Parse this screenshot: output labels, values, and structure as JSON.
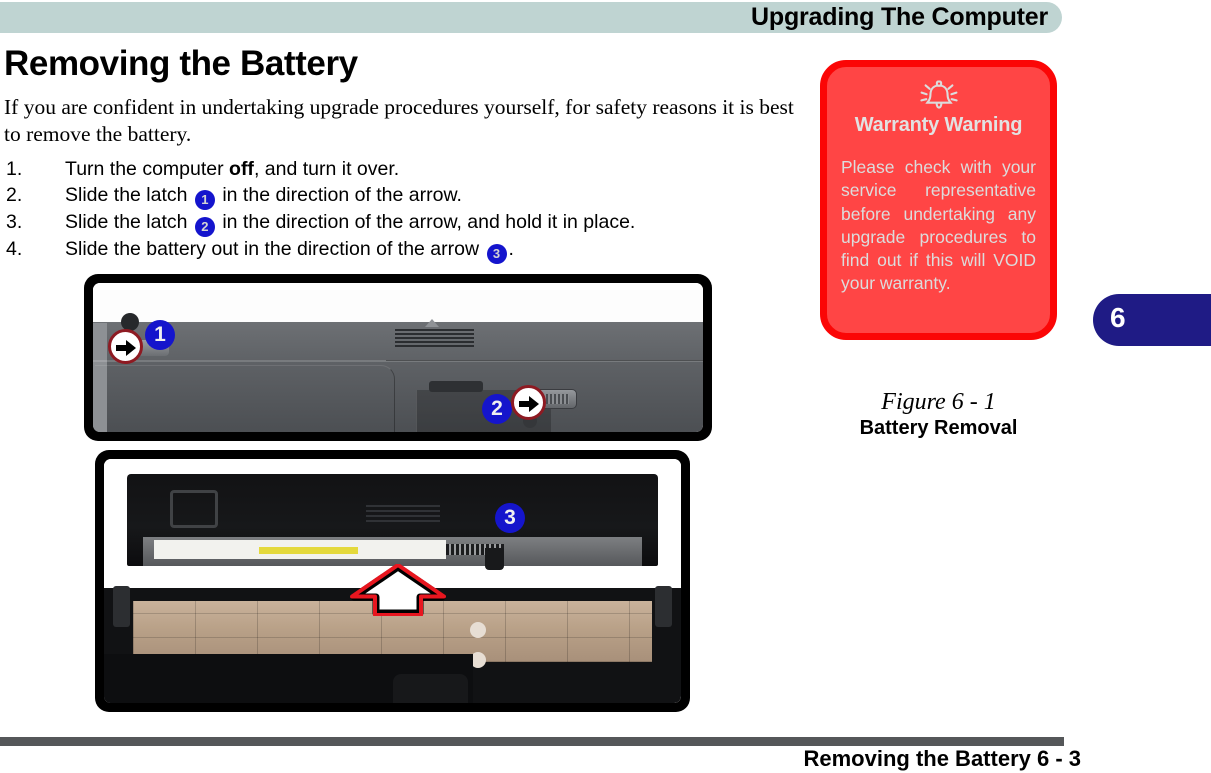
{
  "header": {
    "title": "Upgrading The Computer"
  },
  "chapter_tab": {
    "number": "6"
  },
  "main": {
    "heading": "Removing the Battery",
    "intro": "If you are confident in undertaking upgrade procedures yourself, for safety reasons it is best to remove the battery.",
    "steps": [
      {
        "num": "1.",
        "pre": "Turn the computer ",
        "bold": "off",
        "post": ", and turn it over.",
        "badge": null,
        "tail": ""
      },
      {
        "num": "2.",
        "pre": "Slide the latch ",
        "bold": "",
        "post": "",
        "badge": "1",
        "tail": " in the direction of the arrow."
      },
      {
        "num": "3.",
        "pre": "Slide the latch ",
        "bold": "",
        "post": "",
        "badge": "2",
        "tail": " in the direction of the arrow, and hold it in place."
      },
      {
        "num": "4.",
        "pre": "Slide the battery out in the direction of the arrow ",
        "bold": "",
        "post": "",
        "badge": "3",
        "tail": "."
      }
    ]
  },
  "figures": {
    "photo_one_callouts": [
      {
        "label": "1",
        "icon": "right-arrow-icon"
      },
      {
        "label": "2",
        "icon": "right-arrow-icon"
      }
    ],
    "photo_two_callouts": [
      {
        "label": "3",
        "icon": "up-arrow-icon"
      }
    ],
    "caption_number": "Figure 6 - 1",
    "caption_title": "Battery Removal"
  },
  "warning": {
    "icon": "bell-icon",
    "title": "Warranty Warning",
    "body": "Please check with your service representative before undertaking any upgrade procedures to find out if this will VOID your warranty."
  },
  "footer": {
    "text": "Removing the Battery  6  -  3"
  },
  "colors": {
    "header_bar": "#bfd4d2",
    "chapter_tab": "#1f1b85",
    "badge_blue": "#1515cc",
    "warning_border": "#fb0606",
    "warning_fill": "#ff4545",
    "footer_rule": "#555759"
  }
}
